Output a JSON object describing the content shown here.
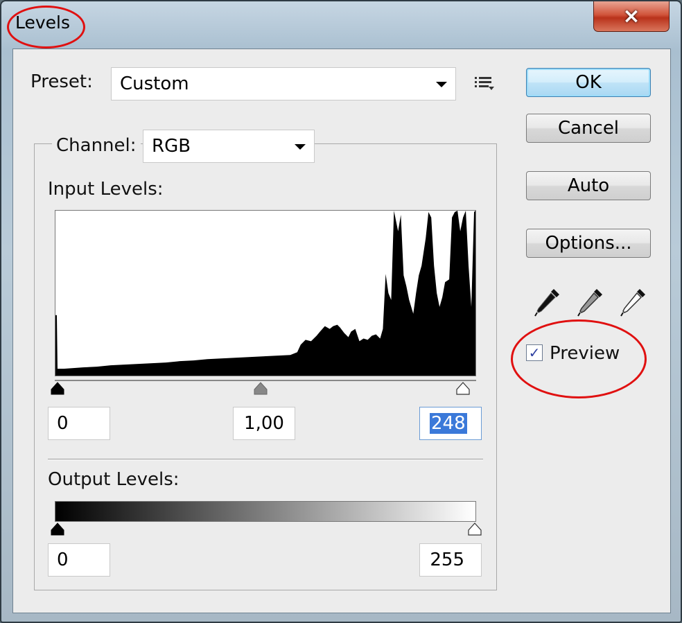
{
  "window": {
    "title": "Levels",
    "close_label": "×"
  },
  "preset": {
    "label": "Preset:",
    "value": "Custom"
  },
  "channel": {
    "label": "Channel:",
    "value": "RGB"
  },
  "input_levels": {
    "label": "Input Levels:",
    "black": "0",
    "gamma": "1,00",
    "white": "248"
  },
  "output_levels": {
    "label": "Output Levels:",
    "black": "0",
    "white": "255"
  },
  "buttons": {
    "ok": "OK",
    "cancel": "Cancel",
    "auto": "Auto",
    "options": "Options..."
  },
  "preview": {
    "label": "Preview",
    "checked": true
  },
  "colors": {
    "highlight_ring": "#e01010",
    "selection": "#3b79d9"
  }
}
